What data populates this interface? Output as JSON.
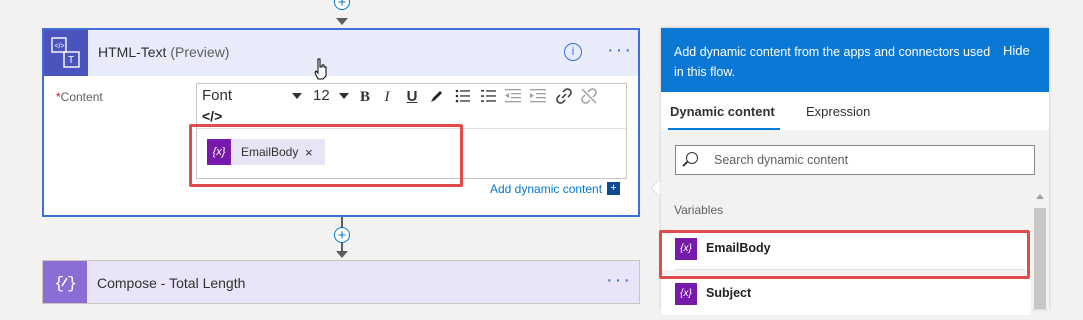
{
  "html_text_card": {
    "title": "HTML-Text",
    "title_suffix": "(Preview)",
    "content_label": "Content",
    "required_mark": "*",
    "toolbar": {
      "font": "Font",
      "size": "12",
      "bold": "B",
      "italic": "I",
      "underline": "U",
      "code_view": "</>"
    },
    "token": {
      "icon_text": "{x}",
      "label": "EmailBody",
      "remove": "×"
    },
    "add_dynamic_content": "Add dynamic content",
    "add_dynamic_plus": "+"
  },
  "compose_card": {
    "title": "Compose - Total Length",
    "icon_text": "{ }"
  },
  "dynamic_panel": {
    "message": "Add dynamic content from the apps and connectors used in this flow.",
    "hide": "Hide",
    "tabs": [
      {
        "label": "Dynamic content",
        "active": true
      },
      {
        "label": "Expression",
        "active": false
      }
    ],
    "search_placeholder": "Search dynamic content",
    "section": "Variables",
    "variables": [
      {
        "icon_text": "{x}",
        "label": "EmailBody"
      },
      {
        "icon_text": "{x}",
        "label": "Subject"
      }
    ]
  },
  "colors": {
    "accent": "#0078d4",
    "card_header": "#e7ebfa",
    "card_icon": "#4b53bc",
    "variable_icon": "#7719aa",
    "highlight": "#e04b4b",
    "compose_icon": "#8c6cd5"
  }
}
